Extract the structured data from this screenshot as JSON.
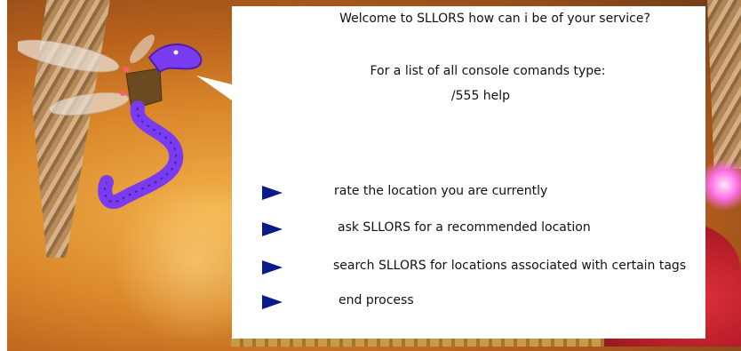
{
  "dialog": {
    "welcome": "Welcome to SLLORS how can i be of your service?",
    "console_hint": "For a list of all console comands type:",
    "help_command": "/555 help"
  },
  "options": [
    {
      "label": "rate the location you are currently",
      "icon": "blue-triangle-arrow-icon"
    },
    {
      "label": "ask SLLORS for a recommended location",
      "icon": "blue-triangle-arrow-icon"
    },
    {
      "label": "search SLLORS for locations associated with certain tags",
      "icon": "blue-triangle-arrow-icon"
    },
    {
      "label": "end process",
      "icon": "blue-triangle-arrow-icon"
    }
  ],
  "colors": {
    "arrow": "#0a1a8c",
    "dialog_bg": "#ffffff",
    "dragonfly_body": "#7a3cf0"
  }
}
